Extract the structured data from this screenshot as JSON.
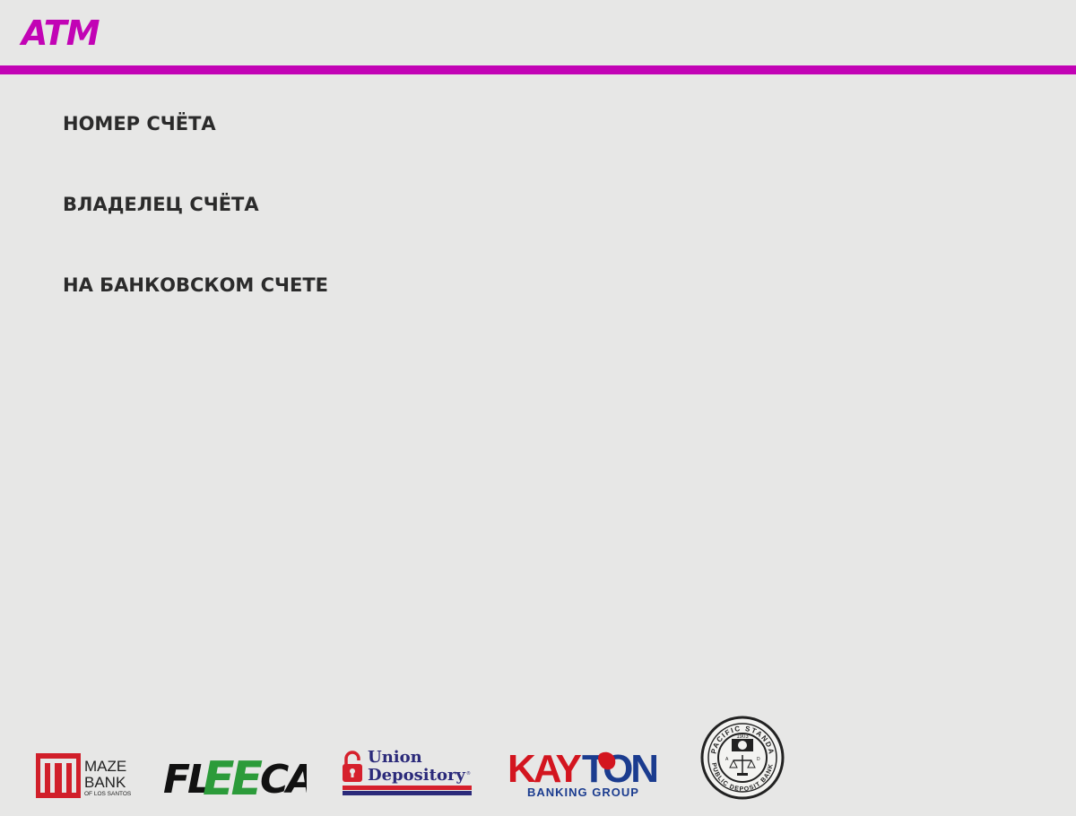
{
  "header": {
    "title": "ATM",
    "accent_color": "#c203b5"
  },
  "account": {
    "number_label": "НОМЕР СЧЁТА",
    "owner_label": "ВЛАДЕЛЕЦ СЧЁТА",
    "balance_label": "НА БАНКОВСКОМ СЧЕТЕ"
  },
  "banks": [
    {
      "name": "Maze Bank",
      "logo_text_1": "MAZE",
      "logo_text_2": "BANK",
      "logo_text_3": "OF LOS SANTOS"
    },
    {
      "name": "Fleeca",
      "logo_text": "FLEECA"
    },
    {
      "name": "Union Depository",
      "logo_text_1": "Union",
      "logo_text_2": "Depository"
    },
    {
      "name": "Kayton Banking Group",
      "logo_text_1": "KAYTON",
      "logo_text_2": "BANKING GROUP"
    },
    {
      "name": "Pacific Standard Public Deposit Bank",
      "logo_text_1": "PACIFIC STANDARD",
      "logo_text_2": "PUBLIC DEPOSIT BANK",
      "logo_year": "1903"
    }
  ]
}
